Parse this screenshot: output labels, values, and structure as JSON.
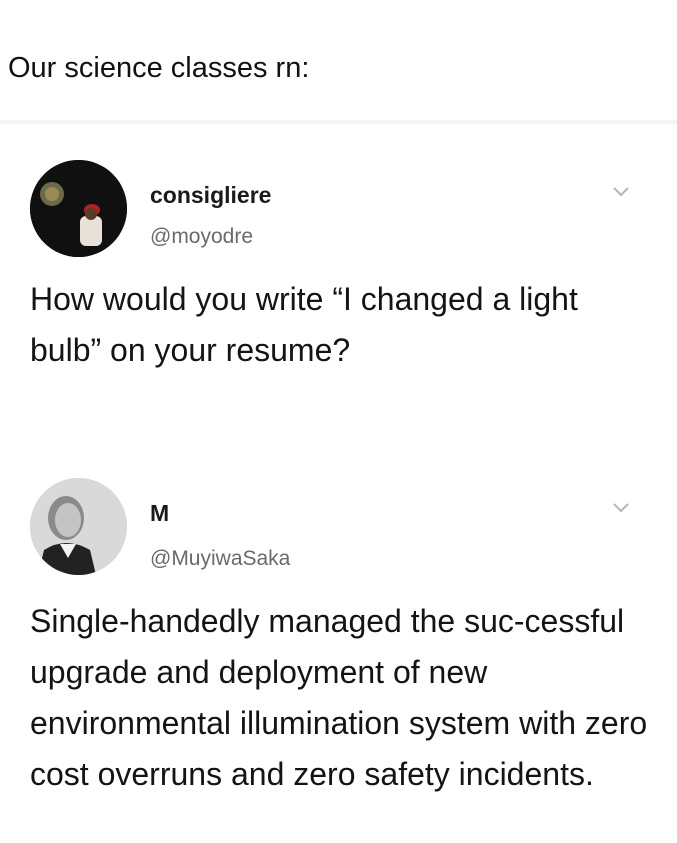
{
  "caption": "Our science classes rn:",
  "tweets": [
    {
      "display_name": "consigliere",
      "handle": "@moyodre",
      "text": "How would you write “I changed a light bulb” on your resume?",
      "avatar_icon": "avatar-photo-icon"
    },
    {
      "display_name": "M",
      "handle": "@MuyiwaSaka",
      "text": "Single-handedly managed the suc-cessful upgrade and deployment of new environmental illumination system with zero cost overruns and zero safety incidents.",
      "avatar_icon": "avatar-portrait-icon"
    }
  ],
  "colors": {
    "text": "#141414",
    "handle": "#6a6a6a",
    "chevron": "#b5b5b5",
    "divider": "#f4f4f4"
  }
}
